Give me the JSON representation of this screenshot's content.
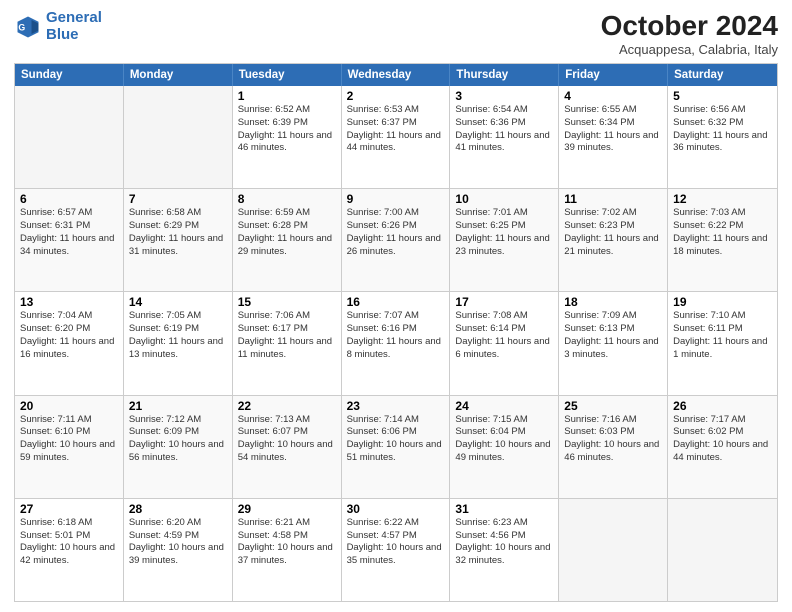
{
  "header": {
    "logo_line1": "General",
    "logo_line2": "Blue",
    "title": "October 2024",
    "subtitle": "Acquappesa, Calabria, Italy"
  },
  "weekdays": [
    "Sunday",
    "Monday",
    "Tuesday",
    "Wednesday",
    "Thursday",
    "Friday",
    "Saturday"
  ],
  "rows": [
    [
      {
        "day": "",
        "text": ""
      },
      {
        "day": "",
        "text": ""
      },
      {
        "day": "1",
        "text": "Sunrise: 6:52 AM\nSunset: 6:39 PM\nDaylight: 11 hours and 46 minutes."
      },
      {
        "day": "2",
        "text": "Sunrise: 6:53 AM\nSunset: 6:37 PM\nDaylight: 11 hours and 44 minutes."
      },
      {
        "day": "3",
        "text": "Sunrise: 6:54 AM\nSunset: 6:36 PM\nDaylight: 11 hours and 41 minutes."
      },
      {
        "day": "4",
        "text": "Sunrise: 6:55 AM\nSunset: 6:34 PM\nDaylight: 11 hours and 39 minutes."
      },
      {
        "day": "5",
        "text": "Sunrise: 6:56 AM\nSunset: 6:32 PM\nDaylight: 11 hours and 36 minutes."
      }
    ],
    [
      {
        "day": "6",
        "text": "Sunrise: 6:57 AM\nSunset: 6:31 PM\nDaylight: 11 hours and 34 minutes."
      },
      {
        "day": "7",
        "text": "Sunrise: 6:58 AM\nSunset: 6:29 PM\nDaylight: 11 hours and 31 minutes."
      },
      {
        "day": "8",
        "text": "Sunrise: 6:59 AM\nSunset: 6:28 PM\nDaylight: 11 hours and 29 minutes."
      },
      {
        "day": "9",
        "text": "Sunrise: 7:00 AM\nSunset: 6:26 PM\nDaylight: 11 hours and 26 minutes."
      },
      {
        "day": "10",
        "text": "Sunrise: 7:01 AM\nSunset: 6:25 PM\nDaylight: 11 hours and 23 minutes."
      },
      {
        "day": "11",
        "text": "Sunrise: 7:02 AM\nSunset: 6:23 PM\nDaylight: 11 hours and 21 minutes."
      },
      {
        "day": "12",
        "text": "Sunrise: 7:03 AM\nSunset: 6:22 PM\nDaylight: 11 hours and 18 minutes."
      }
    ],
    [
      {
        "day": "13",
        "text": "Sunrise: 7:04 AM\nSunset: 6:20 PM\nDaylight: 11 hours and 16 minutes."
      },
      {
        "day": "14",
        "text": "Sunrise: 7:05 AM\nSunset: 6:19 PM\nDaylight: 11 hours and 13 minutes."
      },
      {
        "day": "15",
        "text": "Sunrise: 7:06 AM\nSunset: 6:17 PM\nDaylight: 11 hours and 11 minutes."
      },
      {
        "day": "16",
        "text": "Sunrise: 7:07 AM\nSunset: 6:16 PM\nDaylight: 11 hours and 8 minutes."
      },
      {
        "day": "17",
        "text": "Sunrise: 7:08 AM\nSunset: 6:14 PM\nDaylight: 11 hours and 6 minutes."
      },
      {
        "day": "18",
        "text": "Sunrise: 7:09 AM\nSunset: 6:13 PM\nDaylight: 11 hours and 3 minutes."
      },
      {
        "day": "19",
        "text": "Sunrise: 7:10 AM\nSunset: 6:11 PM\nDaylight: 11 hours and 1 minute."
      }
    ],
    [
      {
        "day": "20",
        "text": "Sunrise: 7:11 AM\nSunset: 6:10 PM\nDaylight: 10 hours and 59 minutes."
      },
      {
        "day": "21",
        "text": "Sunrise: 7:12 AM\nSunset: 6:09 PM\nDaylight: 10 hours and 56 minutes."
      },
      {
        "day": "22",
        "text": "Sunrise: 7:13 AM\nSunset: 6:07 PM\nDaylight: 10 hours and 54 minutes."
      },
      {
        "day": "23",
        "text": "Sunrise: 7:14 AM\nSunset: 6:06 PM\nDaylight: 10 hours and 51 minutes."
      },
      {
        "day": "24",
        "text": "Sunrise: 7:15 AM\nSunset: 6:04 PM\nDaylight: 10 hours and 49 minutes."
      },
      {
        "day": "25",
        "text": "Sunrise: 7:16 AM\nSunset: 6:03 PM\nDaylight: 10 hours and 46 minutes."
      },
      {
        "day": "26",
        "text": "Sunrise: 7:17 AM\nSunset: 6:02 PM\nDaylight: 10 hours and 44 minutes."
      }
    ],
    [
      {
        "day": "27",
        "text": "Sunrise: 6:18 AM\nSunset: 5:01 PM\nDaylight: 10 hours and 42 minutes."
      },
      {
        "day": "28",
        "text": "Sunrise: 6:20 AM\nSunset: 4:59 PM\nDaylight: 10 hours and 39 minutes."
      },
      {
        "day": "29",
        "text": "Sunrise: 6:21 AM\nSunset: 4:58 PM\nDaylight: 10 hours and 37 minutes."
      },
      {
        "day": "30",
        "text": "Sunrise: 6:22 AM\nSunset: 4:57 PM\nDaylight: 10 hours and 35 minutes."
      },
      {
        "day": "31",
        "text": "Sunrise: 6:23 AM\nSunset: 4:56 PM\nDaylight: 10 hours and 32 minutes."
      },
      {
        "day": "",
        "text": ""
      },
      {
        "day": "",
        "text": ""
      }
    ]
  ]
}
